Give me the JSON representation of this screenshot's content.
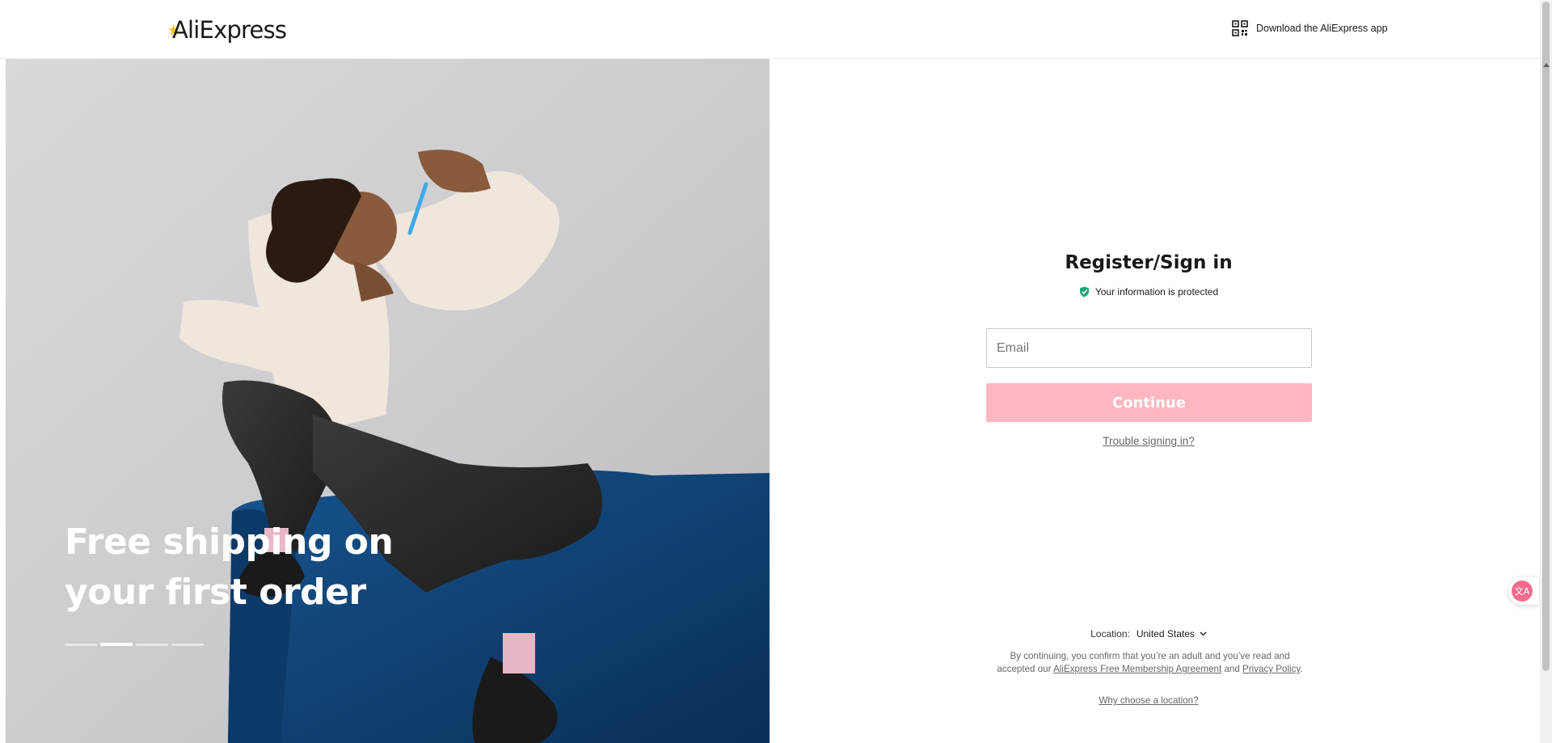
{
  "header": {
    "logo_text": "AliExpress",
    "app_link_label": "Download the AliExpress app",
    "app_icon": "qr-code-icon"
  },
  "hero": {
    "headline": "Free shipping on your first order",
    "carousel_count": 4,
    "carousel_active_index": 1
  },
  "signin": {
    "title": "Register/Sign in",
    "protected_text": "Your information is protected",
    "protected_icon": "shield-check-icon",
    "email_placeholder": "Email",
    "email_value": "",
    "continue_label": "Continue",
    "trouble_label": "Trouble signing in?"
  },
  "footer": {
    "location_label": "Location:",
    "location_value": "United States",
    "terms_prefix": "By continuing, you confirm that you’re an adult and you’ve read and accepted our",
    "membership_link": "AliExpress Free Membership Agreement",
    "terms_and": "and",
    "privacy_link": "Privacy Policy",
    "terms_suffix": ".",
    "why_location": "Why choose a location?"
  },
  "colors": {
    "accent_pink": "#ffb6c1",
    "shield_green": "#1aa67a",
    "sofa_blue": "#0f3d6e"
  }
}
